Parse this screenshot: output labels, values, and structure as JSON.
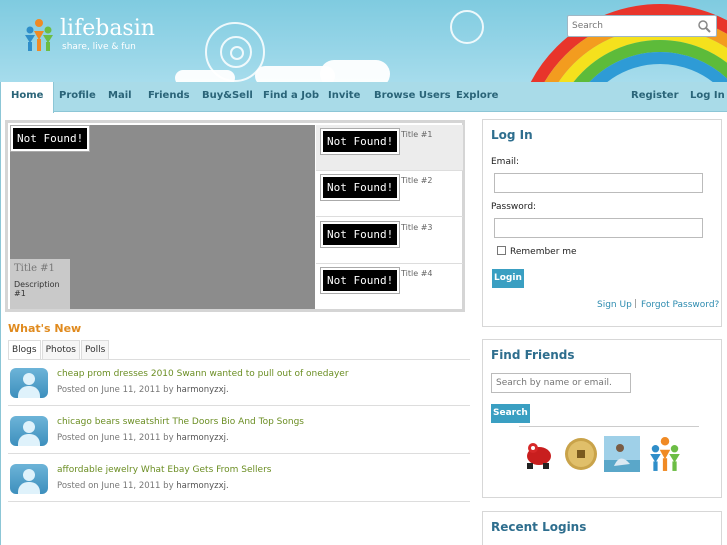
{
  "brand": {
    "name": "lifebasin",
    "tagline": "share, live & fun"
  },
  "search": {
    "placeholder": "Search"
  },
  "nav": {
    "left": [
      "Home",
      "Profile",
      "Mail",
      "Friends",
      "Buy&Sell",
      "Find a Job",
      "Invite",
      "Browse Users",
      "Explore"
    ],
    "right": [
      "Register",
      "Log In"
    ],
    "active": "Home"
  },
  "slider": {
    "not_found": "Not Found!",
    "main_title": "Title #1",
    "main_description": "Description #1",
    "thumbs": [
      "Title #1",
      "Title #2",
      "Title #3",
      "Title #4"
    ]
  },
  "whats_new": {
    "title": "What's New",
    "tabs": [
      "Blogs",
      "Photos",
      "Polls"
    ],
    "posts": [
      {
        "title": "cheap prom dresses 2010 Swann wanted to pull out of onedayer",
        "posted": "Posted on June 11, 2011 by ",
        "user": "harmonyzxj."
      },
      {
        "title": "chicago bears sweatshirt The Doors Bio And Top Songs",
        "posted": "Posted on June 11, 2011 by ",
        "user": "harmonyzxj."
      },
      {
        "title": "affordable jewelry What Ebay Gets From Sellers",
        "posted": "Posted on June 11, 2011 by ",
        "user": "harmonyzxj."
      }
    ]
  },
  "login": {
    "title": "Log In",
    "email_label": "Email:",
    "password_label": "Password:",
    "remember_label": "Remember me",
    "button": "Login",
    "signup": "Sign Up",
    "separator": "|",
    "forgot": "Forgot Password?"
  },
  "find_friends": {
    "title": "Find Friends",
    "placeholder": "Search by name or email.",
    "button": "Search",
    "avatars": [
      "red-robot-avatar",
      "coin-avatar",
      "photo-avatar",
      "lifebasin-logo-avatar"
    ]
  },
  "recent_logins": {
    "title": "Recent Logins"
  },
  "colors": {
    "accent": "#2e6e8e",
    "link": "#6b8e23",
    "orange": "#e08a1e",
    "button": "#3a9fc2",
    "nav": "#a9dbe8"
  }
}
